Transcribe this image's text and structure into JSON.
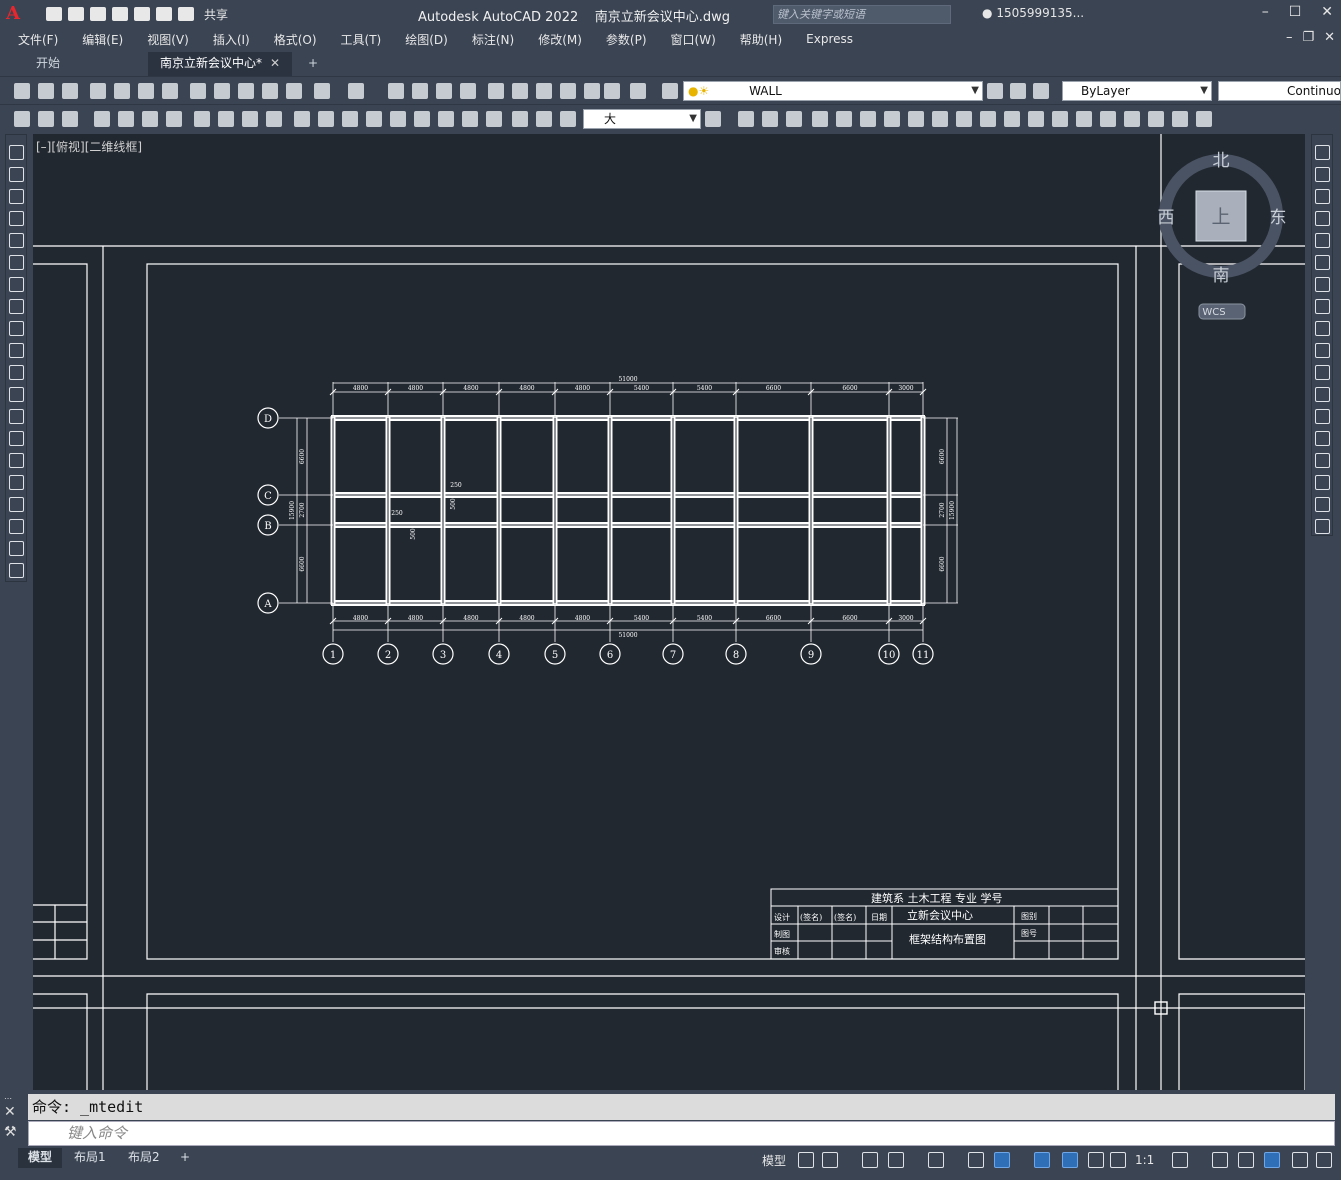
{
  "titlebar": {
    "logo": "A",
    "share_label": "共享",
    "app_title": "Autodesk AutoCAD 2022",
    "file_title": "南京立新会议中心.dwg",
    "search_placeholder": "键入关键字或短语",
    "user_name": "1505999135..."
  },
  "menu": [
    "文件(F)",
    "编辑(E)",
    "视图(V)",
    "插入(I)",
    "格式(O)",
    "工具(T)",
    "绘图(D)",
    "标注(N)",
    "修改(M)",
    "参数(P)",
    "窗口(W)",
    "帮助(H)",
    "Express"
  ],
  "tabs": {
    "start": "开始",
    "drawing": "南京立新会议中心*",
    "add": "+"
  },
  "toolbar": {
    "layer_name": "WALL",
    "color_name": "ByLayer",
    "linetype_name": "Continuous",
    "text_style": "大"
  },
  "viewport": {
    "label": "[–][俯视][二维线框]",
    "compass": {
      "north": "北",
      "south": "南",
      "east": "东",
      "west": "西",
      "top": "上"
    },
    "wcs": "WCS"
  },
  "drawing": {
    "overall_dim": "51000",
    "top_dims": [
      "4800",
      "4800",
      "4800",
      "4800",
      "4800",
      "5400",
      "5400",
      "6600",
      "6600",
      "3000"
    ],
    "bottom_dims": [
      "4800",
      "4800",
      "4800",
      "4800",
      "4800",
      "5400",
      "5400",
      "6600",
      "6600",
      "3000"
    ],
    "left_dims": [
      "6600",
      "2700",
      "6600"
    ],
    "left_total": "15900",
    "right_dims": [
      "6600",
      "2700",
      "6600"
    ],
    "right_total": "15900",
    "axis_rows": [
      "D",
      "C",
      "B",
      "A"
    ],
    "axis_cols": [
      "1",
      "2",
      "3",
      "4",
      "5",
      "6",
      "7",
      "8",
      "9",
      "10",
      "11"
    ],
    "beam_notes": [
      "250",
      "250",
      "500",
      "500"
    ],
    "title_block": {
      "header": "建筑系   土木工程    专业        学号",
      "design": "设计",
      "draw": "制图",
      "check": "审核",
      "name_col": "(签名)",
      "sign_col": "(签名)",
      "date_col": "日期",
      "project": "立新会议中心",
      "sheet_title": "框架结构布置图",
      "sheet_no_label": "图别",
      "drawing_no_label": "图号"
    }
  },
  "command": {
    "history": "命令:  _mtedit",
    "placeholder": "键入命令"
  },
  "status": {
    "tabs": [
      "模型",
      "布局1",
      "布局2"
    ],
    "model_label": "模型",
    "scale": "1:1"
  }
}
